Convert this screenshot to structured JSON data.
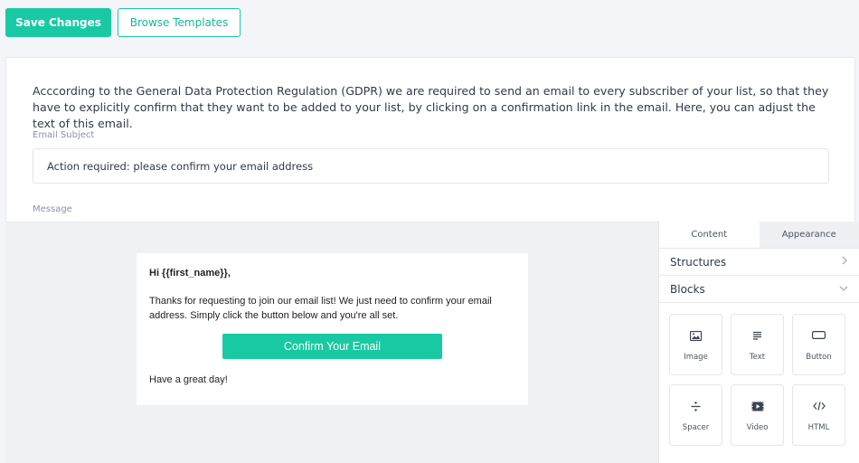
{
  "toolbar": {
    "save_label": "Save Changes",
    "browse_label": "Browse Templates"
  },
  "intro_text": "Acccording to the General Data Protection Regulation (GDPR) we are required to send an email to every subscriber of your list, so that they have to explicitly confirm that they want to be added to your list, by clicking on a confirmation link in the email. Here, you can adjust the text of this email.",
  "subject": {
    "label": "Email Subject",
    "value": "Action required: please confirm your email address"
  },
  "message": {
    "label": "Message"
  },
  "email": {
    "greeting": "Hi {{first_name}},",
    "body": "Thanks for requesting to join our email list! We just need to confirm your email address. Simply click the button below and you're all set.",
    "button_label": "Confirm Your Email",
    "closing": "Have a great day!"
  },
  "panel": {
    "tabs": [
      {
        "label": "Content"
      },
      {
        "label": "Appearance"
      }
    ],
    "structures_label": "Structures",
    "blocks_label": "Blocks",
    "blocks": [
      {
        "label": "Image",
        "icon": "image-icon"
      },
      {
        "label": "Text",
        "icon": "text-icon"
      },
      {
        "label": "Button",
        "icon": "button-icon"
      },
      {
        "label": "Spacer",
        "icon": "divide-icon"
      },
      {
        "label": "Video",
        "icon": "video-icon"
      },
      {
        "label": "HTML",
        "icon": "code-icon"
      }
    ]
  },
  "colors": {
    "accent": "#19c9a4",
    "background": "#f4f5f8",
    "editor_canvas": "#f0f1f3"
  }
}
